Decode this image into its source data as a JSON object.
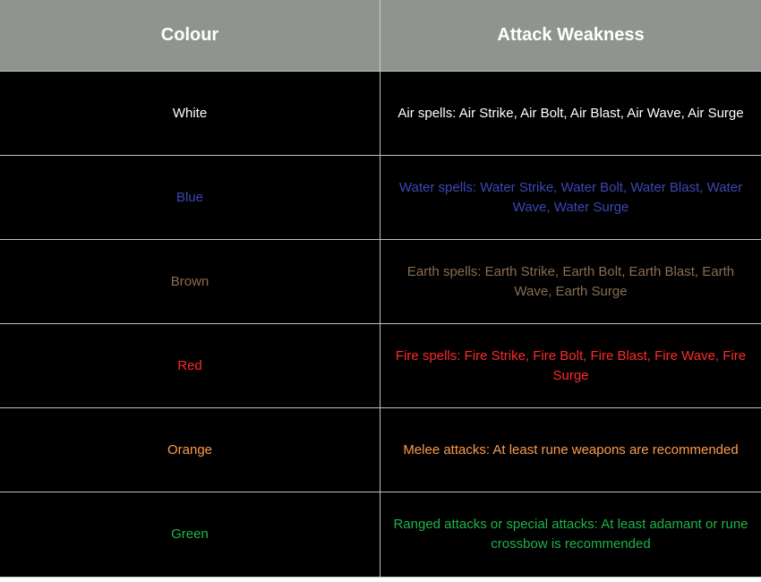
{
  "table": {
    "headers": {
      "colour": "Colour",
      "weakness": "Attack Weakness"
    },
    "rows": [
      {
        "colour": "White",
        "weakness": "Air spells: Air Strike, Air Bolt, Air Blast, Air Wave, Air Surge",
        "color_hex": "#ffffff"
      },
      {
        "colour": "Blue",
        "weakness": "Water spells: Water Strike, Water Bolt, Water Blast, Water Wave, Water Surge",
        "color_hex": "#3b47b5"
      },
      {
        "colour": "Brown",
        "weakness": "Earth spells: Earth Strike, Earth Bolt, Earth Blast, Earth Wave, Earth Surge",
        "color_hex": "#8a6d52"
      },
      {
        "colour": "Red",
        "weakness": "Fire spells: Fire Strike, Fire Bolt, Fire Blast, Fire Wave, Fire Surge",
        "color_hex": "#ff2a2a"
      },
      {
        "colour": "Orange",
        "weakness": "Melee attacks: At least rune weapons are recommended",
        "color_hex": "#ff9a4a"
      },
      {
        "colour": "Green",
        "weakness": "Ranged attacks or special attacks: At least adamant or rune crossbow is recommended",
        "color_hex": "#1fb44a"
      }
    ]
  },
  "colors": {
    "header_background": "#8f958e",
    "header_text": "#ffffff",
    "cell_background": "#000000",
    "border": "#bfc3be"
  }
}
